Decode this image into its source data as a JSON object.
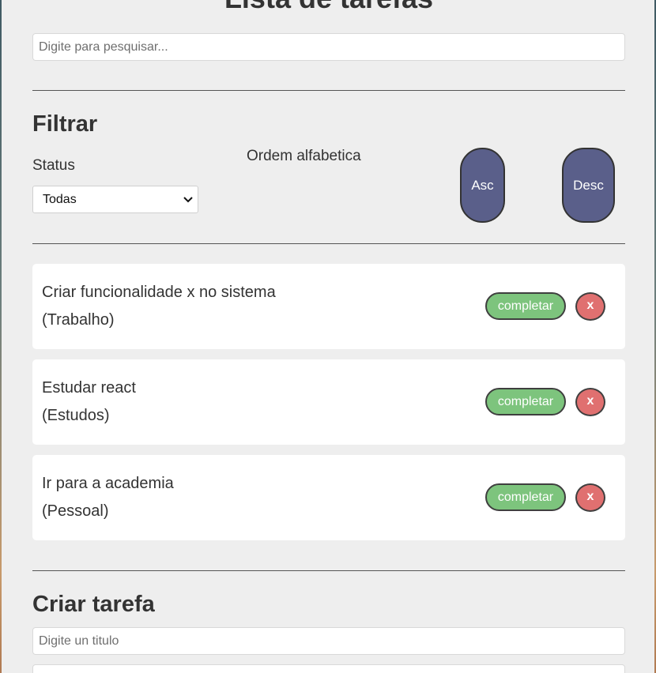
{
  "header": {
    "title": "Lista de tarefas"
  },
  "search": {
    "placeholder": "Digite para pesquisar..."
  },
  "filter": {
    "heading": "Filtrar",
    "status_label": "Status",
    "status_selected": "Todas",
    "order_label": "Ordem alfabetica",
    "asc_label": "Asc",
    "desc_label": "Desc"
  },
  "tasks": [
    {
      "title": "Criar funcionalidade x no sistema",
      "category": "(Trabalho)",
      "complete_label": "completar",
      "delete_label": "x"
    },
    {
      "title": "Estudar react",
      "category": "(Estudos)",
      "complete_label": "completar",
      "delete_label": "x"
    },
    {
      "title": "Ir para a academia",
      "category": "(Pessoal)",
      "complete_label": "completar",
      "delete_label": "x"
    }
  ],
  "create": {
    "heading": "Criar tarefa",
    "title_placeholder": "Digite un titulo"
  },
  "colors": {
    "panel_bg": "#eeeeee",
    "order_button": "#5a5f8a",
    "complete_button": "#7dc47d",
    "delete_button": "#e07070"
  }
}
